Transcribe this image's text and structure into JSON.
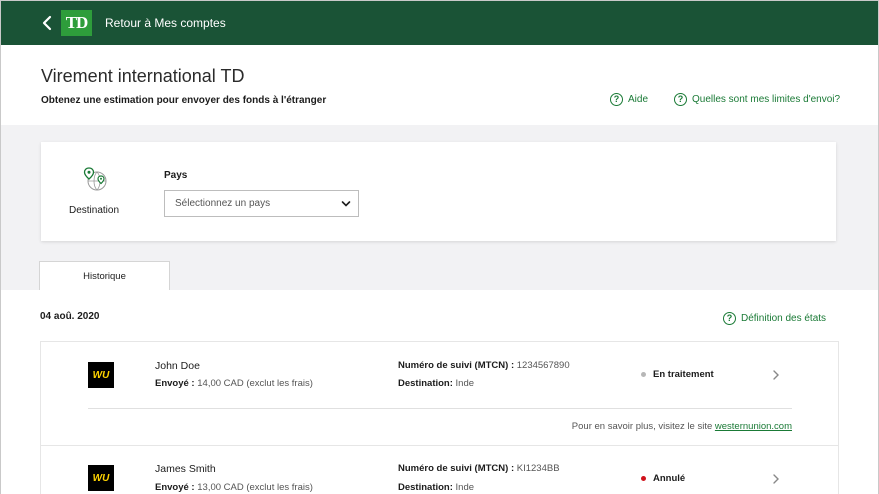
{
  "topbar": {
    "back_label": "Retour à Mes comptes",
    "logo_text": "TD"
  },
  "header": {
    "title": "Virement international TD",
    "subtitle": "Obtenez une estimation pour envoyer des fonds à l'étranger",
    "help_label": "Aide",
    "limits_label": "Quelles sont mes limites d'envoi?"
  },
  "destination": {
    "label": "Destination",
    "country_label": "Pays",
    "country_placeholder": "Sélectionnez un pays"
  },
  "tabs": [
    {
      "label": "Historique"
    }
  ],
  "history": {
    "date": "04 aoû. 2020",
    "states_link": "Définition des états",
    "transactions": [
      {
        "logo": "WU",
        "name": "John Doe",
        "sent_label": "Envoyé :",
        "sent_value": "14,00 CAD (exclut les frais)",
        "mtcn_label": "Numéro de suivi (MTCN) :",
        "mtcn_value": "1234567890",
        "dest_label": "Destination:",
        "dest_value": "Inde",
        "status": "En traitement",
        "status_color": "#b7b7b7",
        "more_text": "Pour en savoir plus, visitez le site",
        "more_link": "westernunion.com"
      },
      {
        "logo": "WU",
        "name": "James Smith",
        "sent_label": "Envoyé :",
        "sent_value": "13,00 CAD (exclut les frais)",
        "mtcn_label": "Numéro de suivi (MTCN) :",
        "mtcn_value": "KI1234BB",
        "dest_label": "Destination:",
        "dest_value": "Inde",
        "status": "Annulé",
        "status_color": "#d0121b"
      }
    ]
  },
  "colors": {
    "brand_dark": "#1a5336",
    "brand_green": "#2e9d3b",
    "link_green": "#1a7a36"
  }
}
